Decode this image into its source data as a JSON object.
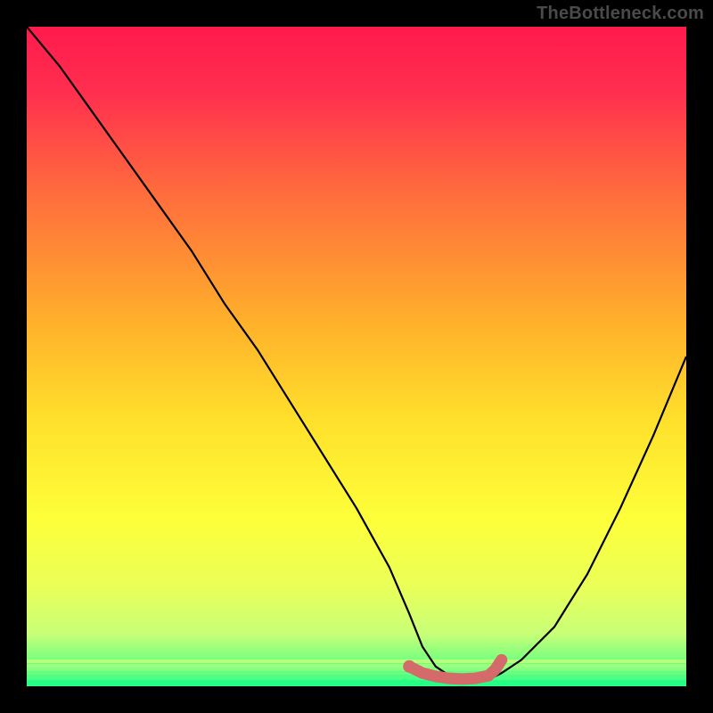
{
  "watermark": "TheBottleneck.com",
  "chart_data": {
    "type": "line",
    "title": "",
    "xlabel": "",
    "ylabel": "",
    "xlim": [
      0,
      100
    ],
    "ylim": [
      0,
      100
    ],
    "grid": false,
    "legend": false,
    "series": [
      {
        "name": "bottleneck-curve",
        "color": "#000000",
        "x": [
          0,
          5,
          10,
          15,
          20,
          25,
          30,
          35,
          40,
          45,
          50,
          55,
          58,
          60,
          62,
          65,
          68,
          70,
          72,
          75,
          80,
          85,
          90,
          95,
          100
        ],
        "values": [
          100,
          94,
          87,
          80,
          73,
          66,
          58,
          51,
          43,
          35,
          27,
          18,
          11,
          6,
          3,
          1,
          1,
          1,
          2,
          4,
          9,
          17,
          27,
          38,
          50
        ]
      },
      {
        "name": "optimal-range-marker",
        "color": "#d46a6a",
        "x": [
          58,
          60,
          62,
          64,
          66,
          68,
          70,
          71,
          72
        ],
        "values": [
          3.0,
          2.0,
          1.5,
          1.2,
          1.1,
          1.2,
          1.6,
          2.5,
          4.0
        ]
      }
    ],
    "background_gradient": {
      "stops": [
        {
          "pos": 0.0,
          "color": "#ff1a4d"
        },
        {
          "pos": 0.1,
          "color": "#ff2f4f"
        },
        {
          "pos": 0.25,
          "color": "#ff6b3d"
        },
        {
          "pos": 0.45,
          "color": "#ffb12b"
        },
        {
          "pos": 0.6,
          "color": "#ffe12b"
        },
        {
          "pos": 0.75,
          "color": "#fdff3a"
        },
        {
          "pos": 0.85,
          "color": "#eaff58"
        },
        {
          "pos": 0.92,
          "color": "#c8ff78"
        },
        {
          "pos": 1.0,
          "color": "#2bff86"
        }
      ]
    },
    "green_bands": [
      {
        "y": 96.0,
        "h": 0.5,
        "color": "#b6ff7a"
      },
      {
        "y": 96.6,
        "h": 0.5,
        "color": "#9dff7d"
      },
      {
        "y": 97.2,
        "h": 0.5,
        "color": "#84ff80"
      },
      {
        "y": 97.8,
        "h": 0.5,
        "color": "#6bff82"
      },
      {
        "y": 98.4,
        "h": 0.6,
        "color": "#4dff84"
      },
      {
        "y": 99.1,
        "h": 0.9,
        "color": "#26ff86"
      }
    ]
  }
}
